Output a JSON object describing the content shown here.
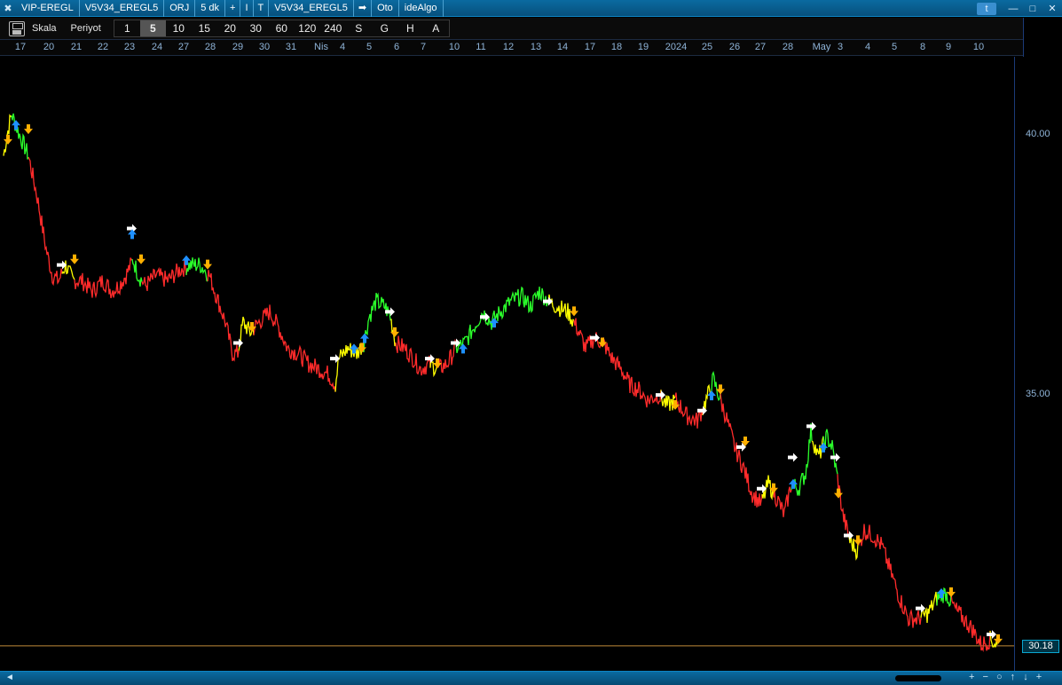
{
  "titlebar": {
    "close_glyph": "✖",
    "segments": [
      "VIP-EREGL",
      "V5V34_EREGL5",
      "ORJ",
      "5 dk",
      "+",
      "I",
      "T",
      "V5V34_EREGL5",
      "➡",
      "Oto",
      "ideAlgo"
    ]
  },
  "toolbar": {
    "scale_label": "Skala",
    "period_label": "Periyot",
    "periods": [
      "1",
      "5",
      "10",
      "15",
      "20",
      "30",
      "60",
      "120",
      "240",
      "S",
      "G",
      "H",
      "A"
    ],
    "selected_period": "5"
  },
  "dates": [
    "17",
    "20",
    "21",
    "22",
    "23",
    "24",
    "27",
    "28",
    "29",
    "30",
    "31",
    "Nis",
    "4",
    "5",
    "6",
    "7",
    "10",
    "11",
    "12",
    "13",
    "14",
    "17",
    "18",
    "19",
    "2024",
    "25",
    "26",
    "27",
    "28",
    "May",
    "3",
    "4",
    "5",
    "8",
    "9",
    "10"
  ],
  "colors": {
    "down": "#ff2b2b",
    "up": "#2bff2b",
    "neutral": "#ffff00",
    "buy_arrow": "#1e90ff",
    "sell_arrow": "#ffb000",
    "entry_arrow": "#ffffff",
    "last_line": "#c08a3a",
    "axis_text": "#8fb4d8"
  },
  "chart_data": {
    "type": "line",
    "y_ticks": [
      40.0,
      35.0
    ],
    "y_tick_labels": [
      "40.00",
      "35.00"
    ],
    "last_price": 30.18,
    "last_price_label": "30.18",
    "ylim": [
      29.7,
      41.5
    ],
    "price_path": [
      {
        "i": 0,
        "y": 39.6
      },
      {
        "i": 4,
        "y": 40.0
      },
      {
        "i": 9,
        "y": 40.4
      },
      {
        "i": 18,
        "y": 40.0
      },
      {
        "i": 28,
        "y": 39.6
      },
      {
        "i": 38,
        "y": 38.8
      },
      {
        "i": 48,
        "y": 37.8
      },
      {
        "i": 55,
        "y": 37.3
      },
      {
        "i": 62,
        "y": 37.2
      },
      {
        "i": 70,
        "y": 37.5
      },
      {
        "i": 78,
        "y": 37.2
      },
      {
        "i": 88,
        "y": 37.2
      },
      {
        "i": 100,
        "y": 37.0
      },
      {
        "i": 112,
        "y": 37.2
      },
      {
        "i": 122,
        "y": 37.0
      },
      {
        "i": 130,
        "y": 37.1
      },
      {
        "i": 138,
        "y": 37.3
      },
      {
        "i": 146,
        "y": 37.6
      },
      {
        "i": 152,
        "y": 37.3
      },
      {
        "i": 160,
        "y": 37.1
      },
      {
        "i": 172,
        "y": 37.3
      },
      {
        "i": 185,
        "y": 37.2
      },
      {
        "i": 198,
        "y": 37.4
      },
      {
        "i": 210,
        "y": 37.5
      },
      {
        "i": 222,
        "y": 37.5
      },
      {
        "i": 232,
        "y": 37.3
      },
      {
        "i": 240,
        "y": 36.9
      },
      {
        "i": 250,
        "y": 36.4
      },
      {
        "i": 258,
        "y": 35.8
      },
      {
        "i": 264,
        "y": 35.8
      },
      {
        "i": 270,
        "y": 36.4
      },
      {
        "i": 278,
        "y": 36.2
      },
      {
        "i": 288,
        "y": 36.4
      },
      {
        "i": 300,
        "y": 36.6
      },
      {
        "i": 310,
        "y": 36.3
      },
      {
        "i": 320,
        "y": 35.9
      },
      {
        "i": 332,
        "y": 35.8
      },
      {
        "i": 344,
        "y": 35.6
      },
      {
        "i": 356,
        "y": 35.5
      },
      {
        "i": 366,
        "y": 35.4
      },
      {
        "i": 374,
        "y": 35.2
      },
      {
        "i": 378,
        "y": 35.7
      },
      {
        "i": 388,
        "y": 35.9
      },
      {
        "i": 398,
        "y": 35.8
      },
      {
        "i": 406,
        "y": 36.0
      },
      {
        "i": 412,
        "y": 36.5
      },
      {
        "i": 420,
        "y": 36.8
      },
      {
        "i": 430,
        "y": 36.7
      },
      {
        "i": 436,
        "y": 36.5
      },
      {
        "i": 442,
        "y": 36.0
      },
      {
        "i": 452,
        "y": 35.9
      },
      {
        "i": 462,
        "y": 35.7
      },
      {
        "i": 470,
        "y": 35.5
      },
      {
        "i": 480,
        "y": 35.6
      },
      {
        "i": 490,
        "y": 35.5
      },
      {
        "i": 500,
        "y": 35.6
      },
      {
        "i": 510,
        "y": 35.9
      },
      {
        "i": 520,
        "y": 36.0
      },
      {
        "i": 530,
        "y": 36.3
      },
      {
        "i": 540,
        "y": 36.6
      },
      {
        "i": 550,
        "y": 36.4
      },
      {
        "i": 560,
        "y": 36.6
      },
      {
        "i": 572,
        "y": 36.8
      },
      {
        "i": 584,
        "y": 36.9
      },
      {
        "i": 594,
        "y": 36.7
      },
      {
        "i": 604,
        "y": 37.0
      },
      {
        "i": 614,
        "y": 36.8
      },
      {
        "i": 624,
        "y": 36.7
      },
      {
        "i": 636,
        "y": 36.6
      },
      {
        "i": 646,
        "y": 36.3
      },
      {
        "i": 656,
        "y": 35.9
      },
      {
        "i": 666,
        "y": 36.1
      },
      {
        "i": 676,
        "y": 36.0
      },
      {
        "i": 686,
        "y": 35.7
      },
      {
        "i": 696,
        "y": 35.5
      },
      {
        "i": 706,
        "y": 35.2
      },
      {
        "i": 716,
        "y": 35.1
      },
      {
        "i": 726,
        "y": 34.9
      },
      {
        "i": 738,
        "y": 35.0
      },
      {
        "i": 748,
        "y": 34.8
      },
      {
        "i": 758,
        "y": 34.9
      },
      {
        "i": 770,
        "y": 34.6
      },
      {
        "i": 782,
        "y": 34.5
      },
      {
        "i": 792,
        "y": 34.9
      },
      {
        "i": 800,
        "y": 35.3
      },
      {
        "i": 806,
        "y": 35.0
      },
      {
        "i": 814,
        "y": 34.6
      },
      {
        "i": 824,
        "y": 34.0
      },
      {
        "i": 834,
        "y": 33.6
      },
      {
        "i": 844,
        "y": 33.1
      },
      {
        "i": 854,
        "y": 32.9
      },
      {
        "i": 862,
        "y": 33.3
      },
      {
        "i": 872,
        "y": 33.0
      },
      {
        "i": 880,
        "y": 32.7
      },
      {
        "i": 888,
        "y": 33.3
      },
      {
        "i": 896,
        "y": 33.2
      },
      {
        "i": 904,
        "y": 33.5
      },
      {
        "i": 910,
        "y": 34.3
      },
      {
        "i": 918,
        "y": 33.8
      },
      {
        "i": 928,
        "y": 34.2
      },
      {
        "i": 934,
        "y": 34.0
      },
      {
        "i": 940,
        "y": 33.4
      },
      {
        "i": 946,
        "y": 32.7
      },
      {
        "i": 954,
        "y": 32.2
      },
      {
        "i": 962,
        "y": 32.0
      },
      {
        "i": 970,
        "y": 32.4
      },
      {
        "i": 980,
        "y": 32.3
      },
      {
        "i": 990,
        "y": 32.1
      },
      {
        "i": 1000,
        "y": 31.6
      },
      {
        "i": 1010,
        "y": 31.1
      },
      {
        "i": 1020,
        "y": 30.7
      },
      {
        "i": 1030,
        "y": 30.7
      },
      {
        "i": 1042,
        "y": 30.8
      },
      {
        "i": 1052,
        "y": 31.1
      },
      {
        "i": 1062,
        "y": 31.2
      },
      {
        "i": 1072,
        "y": 30.9
      },
      {
        "i": 1082,
        "y": 30.7
      },
      {
        "i": 1092,
        "y": 30.5
      },
      {
        "i": 1102,
        "y": 30.2
      },
      {
        "i": 1112,
        "y": 30.3
      },
      {
        "i": 1120,
        "y": 30.2
      }
    ],
    "signals": [
      {
        "i": 5,
        "y": 39.9,
        "kind": "sell"
      },
      {
        "i": 14,
        "y": 40.2,
        "kind": "buy"
      },
      {
        "i": 28,
        "y": 40.1,
        "kind": "sell"
      },
      {
        "i": 66,
        "y": 37.5,
        "kind": "entry"
      },
      {
        "i": 80,
        "y": 37.6,
        "kind": "sell"
      },
      {
        "i": 145,
        "y": 38.2,
        "kind": "entry"
      },
      {
        "i": 145,
        "y": 38.1,
        "kind": "buy"
      },
      {
        "i": 155,
        "y": 37.6,
        "kind": "sell"
      },
      {
        "i": 206,
        "y": 37.6,
        "kind": "buy"
      },
      {
        "i": 230,
        "y": 37.5,
        "kind": "sell"
      },
      {
        "i": 265,
        "y": 36.0,
        "kind": "entry"
      },
      {
        "i": 280,
        "y": 36.3,
        "kind": "sell"
      },
      {
        "i": 374,
        "y": 35.7,
        "kind": "entry"
      },
      {
        "i": 395,
        "y": 35.9,
        "kind": "buy"
      },
      {
        "i": 404,
        "y": 35.9,
        "kind": "sell"
      },
      {
        "i": 407,
        "y": 36.1,
        "kind": "buy"
      },
      {
        "i": 436,
        "y": 36.6,
        "kind": "entry"
      },
      {
        "i": 441,
        "y": 36.2,
        "kind": "sell"
      },
      {
        "i": 481,
        "y": 35.7,
        "kind": "entry"
      },
      {
        "i": 489,
        "y": 35.6,
        "kind": "sell"
      },
      {
        "i": 510,
        "y": 36.0,
        "kind": "entry"
      },
      {
        "i": 518,
        "y": 35.9,
        "kind": "buy"
      },
      {
        "i": 543,
        "y": 36.5,
        "kind": "entry"
      },
      {
        "i": 553,
        "y": 36.4,
        "kind": "buy"
      },
      {
        "i": 614,
        "y": 36.8,
        "kind": "entry"
      },
      {
        "i": 643,
        "y": 36.6,
        "kind": "sell"
      },
      {
        "i": 667,
        "y": 36.1,
        "kind": "entry"
      },
      {
        "i": 675,
        "y": 36.0,
        "kind": "sell"
      },
      {
        "i": 741,
        "y": 35.0,
        "kind": "entry"
      },
      {
        "i": 757,
        "y": 34.8,
        "kind": "sell"
      },
      {
        "i": 788,
        "y": 34.7,
        "kind": "entry"
      },
      {
        "i": 798,
        "y": 35.0,
        "kind": "buy"
      },
      {
        "i": 808,
        "y": 35.1,
        "kind": "sell"
      },
      {
        "i": 832,
        "y": 34.0,
        "kind": "entry"
      },
      {
        "i": 836,
        "y": 34.1,
        "kind": "sell"
      },
      {
        "i": 855,
        "y": 33.2,
        "kind": "entry"
      },
      {
        "i": 868,
        "y": 33.2,
        "kind": "sell"
      },
      {
        "i": 890,
        "y": 33.8,
        "kind": "entry"
      },
      {
        "i": 890,
        "y": 33.3,
        "kind": "buy"
      },
      {
        "i": 911,
        "y": 34.4,
        "kind": "entry"
      },
      {
        "i": 924,
        "y": 34.0,
        "kind": "buy"
      },
      {
        "i": 938,
        "y": 33.8,
        "kind": "entry"
      },
      {
        "i": 941,
        "y": 33.1,
        "kind": "sell"
      },
      {
        "i": 953,
        "y": 32.3,
        "kind": "entry"
      },
      {
        "i": 963,
        "y": 32.2,
        "kind": "sell"
      },
      {
        "i": 1034,
        "y": 30.9,
        "kind": "entry"
      },
      {
        "i": 1057,
        "y": 31.2,
        "kind": "buy"
      },
      {
        "i": 1068,
        "y": 31.2,
        "kind": "sell"
      },
      {
        "i": 1114,
        "y": 30.4,
        "kind": "entry"
      },
      {
        "i": 1121,
        "y": 30.3,
        "kind": "sell"
      }
    ],
    "segments_color": [
      {
        "from": 0,
        "to": 9,
        "c": "neutral"
      },
      {
        "from": 9,
        "to": 28,
        "c": "up"
      },
      {
        "from": 28,
        "to": 66,
        "c": "down"
      },
      {
        "from": 66,
        "to": 80,
        "c": "neutral"
      },
      {
        "from": 80,
        "to": 145,
        "c": "down"
      },
      {
        "from": 145,
        "to": 156,
        "c": "up"
      },
      {
        "from": 156,
        "to": 206,
        "c": "down"
      },
      {
        "from": 206,
        "to": 230,
        "c": "up"
      },
      {
        "from": 230,
        "to": 265,
        "c": "down"
      },
      {
        "from": 265,
        "to": 282,
        "c": "neutral"
      },
      {
        "from": 282,
        "to": 374,
        "c": "down"
      },
      {
        "from": 374,
        "to": 406,
        "c": "neutral"
      },
      {
        "from": 406,
        "to": 437,
        "c": "up"
      },
      {
        "from": 437,
        "to": 442,
        "c": "neutral"
      },
      {
        "from": 442,
        "to": 481,
        "c": "down"
      },
      {
        "from": 481,
        "to": 490,
        "c": "neutral"
      },
      {
        "from": 490,
        "to": 510,
        "c": "down"
      },
      {
        "from": 510,
        "to": 614,
        "c": "up"
      },
      {
        "from": 614,
        "to": 643,
        "c": "neutral"
      },
      {
        "from": 643,
        "to": 741,
        "c": "down"
      },
      {
        "from": 741,
        "to": 757,
        "c": "neutral"
      },
      {
        "from": 757,
        "to": 788,
        "c": "down"
      },
      {
        "from": 788,
        "to": 798,
        "c": "neutral"
      },
      {
        "from": 798,
        "to": 808,
        "c": "up"
      },
      {
        "from": 808,
        "to": 855,
        "c": "down"
      },
      {
        "from": 855,
        "to": 868,
        "c": "neutral"
      },
      {
        "from": 868,
        "to": 888,
        "c": "down"
      },
      {
        "from": 888,
        "to": 911,
        "c": "up"
      },
      {
        "from": 911,
        "to": 924,
        "c": "neutral"
      },
      {
        "from": 924,
        "to": 940,
        "c": "up"
      },
      {
        "from": 940,
        "to": 953,
        "c": "down"
      },
      {
        "from": 953,
        "to": 963,
        "c": "neutral"
      },
      {
        "from": 963,
        "to": 1034,
        "c": "down"
      },
      {
        "from": 1034,
        "to": 1052,
        "c": "neutral"
      },
      {
        "from": 1052,
        "to": 1068,
        "c": "up"
      },
      {
        "from": 1068,
        "to": 1112,
        "c": "down"
      },
      {
        "from": 1112,
        "to": 1124,
        "c": "neutral"
      }
    ]
  },
  "scrollbar": {
    "left_glyph": "◄",
    "controls": "+ − ○ ↑ ↓ +"
  }
}
